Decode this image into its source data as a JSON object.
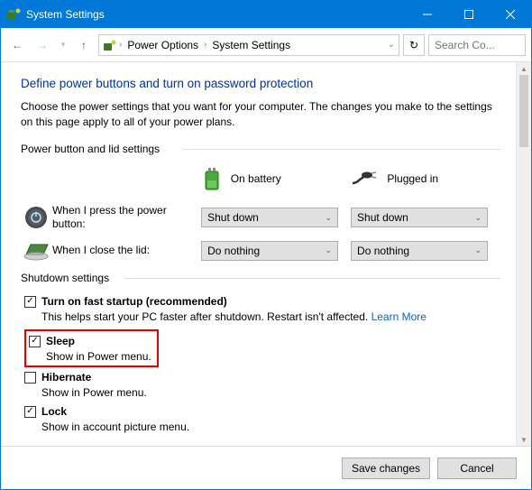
{
  "titlebar": {
    "title": "System Settings"
  },
  "breadcrumb": {
    "crumb1": "Power Options",
    "crumb2": "System Settings"
  },
  "search": {
    "placeholder": "Search Co..."
  },
  "heading": "Define power buttons and turn on password protection",
  "intro": "Choose the power settings that you want for your computer. The changes you make to the settings on this page apply to all of your power plans.",
  "group1": {
    "label": "Power button and lid settings"
  },
  "cols": {
    "battery": "On battery",
    "plugged": "Plugged in"
  },
  "row1": {
    "label": "When I press the power button:",
    "battery": "Shut down",
    "plugged": "Shut down"
  },
  "row2": {
    "label": "When I close the lid:",
    "battery": "Do nothing",
    "plugged": "Do nothing"
  },
  "group2": {
    "label": "Shutdown settings"
  },
  "fast": {
    "label": "Turn on fast startup (recommended)",
    "sub": "This helps start your PC faster after shutdown. Restart isn't affected. ",
    "link": "Learn More"
  },
  "sleep": {
    "label": "Sleep",
    "sub": "Show in Power menu."
  },
  "hibernate": {
    "label": "Hibernate",
    "sub": "Show in Power menu."
  },
  "lock": {
    "label": "Lock",
    "sub": "Show in account picture menu."
  },
  "footer": {
    "save": "Save changes",
    "cancel": "Cancel"
  }
}
